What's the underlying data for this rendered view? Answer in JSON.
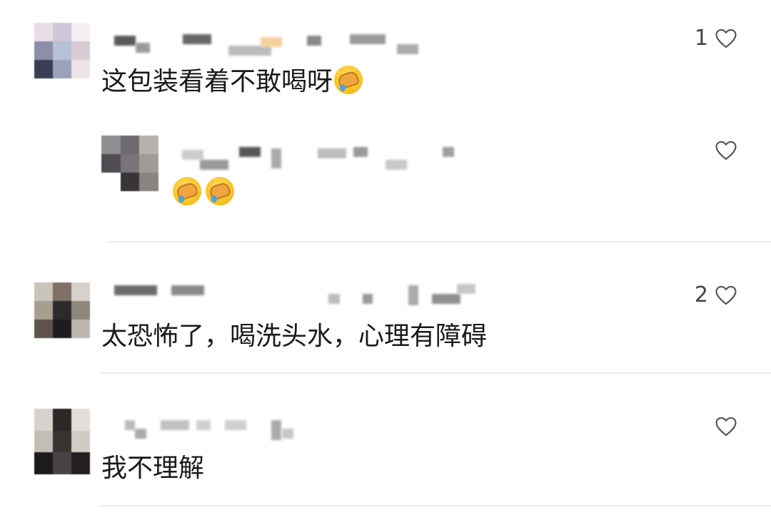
{
  "comments": [
    {
      "text": "这包装看着不敢喝呀",
      "emoji_count": 1,
      "like_count": "1",
      "icons": {
        "like": "heart-icon",
        "emoji": "facepalm-crying-emoji"
      }
    },
    {
      "text": "",
      "emoji_count": 2,
      "like_count": "",
      "icons": {
        "like": "heart-icon",
        "emoji": "facepalm-crying-emoji"
      }
    },
    {
      "text": "太恐怖了，喝洗头水，心理有障碍",
      "like_count": "2",
      "icons": {
        "like": "heart-icon"
      }
    },
    {
      "text": "我不理解",
      "like_count": "",
      "icons": {
        "like": "heart-icon"
      }
    }
  ],
  "colors": {
    "text": "#1a1a1a",
    "like": "#555555",
    "divider": "#ececec"
  }
}
